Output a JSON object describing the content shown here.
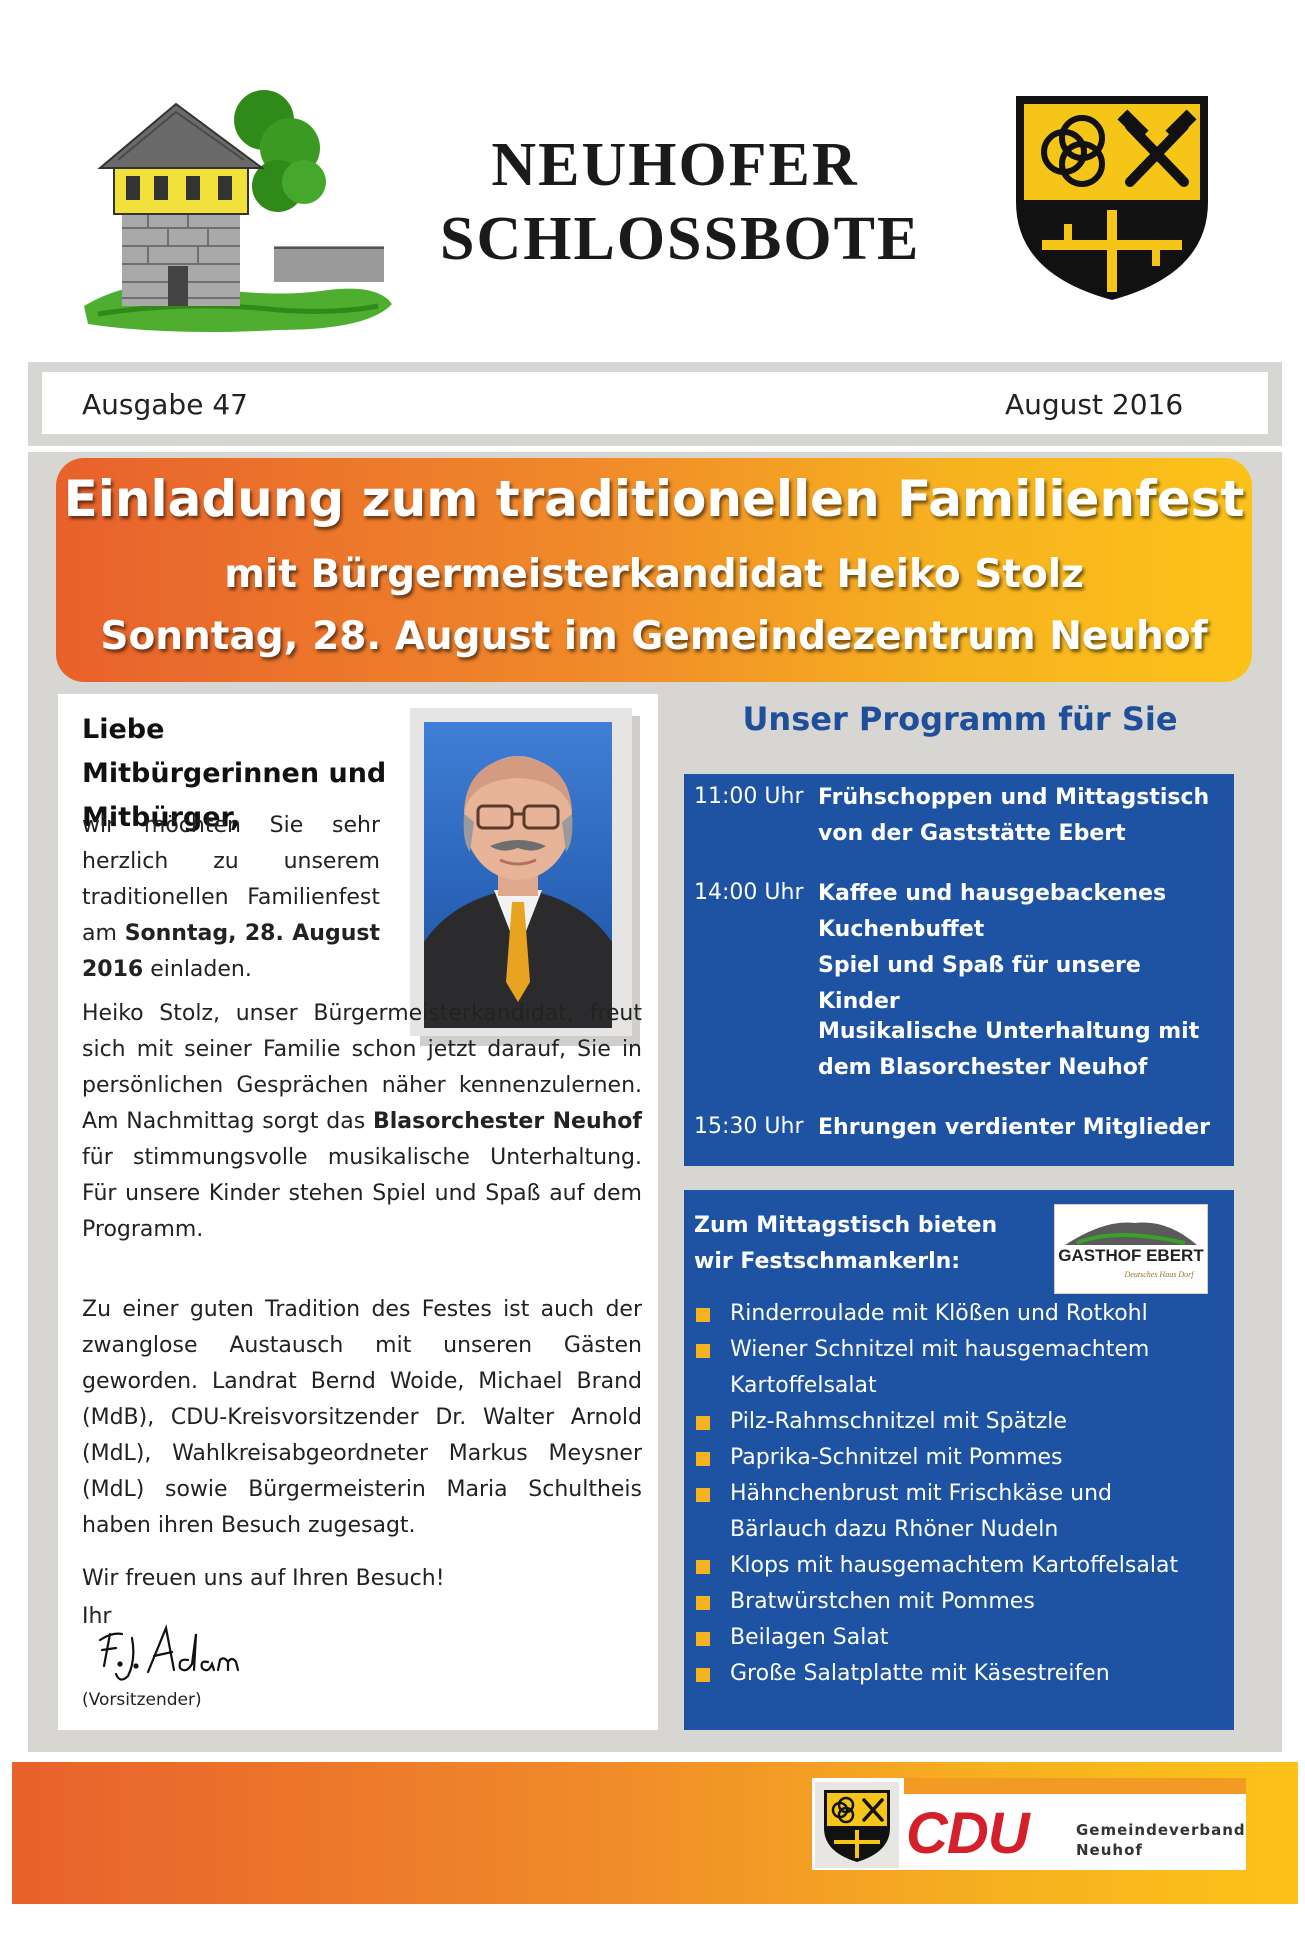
{
  "header": {
    "title_line1": "NEUHOFER",
    "title_line2": "SCHLOSSBOTE",
    "tower_logo": "tower-illustration",
    "crest_icon": "municipal-coat-of-arms"
  },
  "issue": {
    "edition": "Ausgabe  47",
    "date": "August 2016"
  },
  "banner": {
    "title": "Einladung zum traditionellen Familienfest",
    "subtitle": "mit Bürgermeisterkandidat Heiko Stolz",
    "date_line": "Sonntag, 28. August im Gemeindezentrum Neuhof"
  },
  "letter": {
    "greeting": "Liebe Mitbürgerinnen und Mitbürger,",
    "p1_text": "wir möchten Sie sehr herzlich zu unserem traditionellen Familienfest am ",
    "p1_bold": "Sonntag, 28. August 2016",
    "p1_tail": " einladen.",
    "p2_text": "Heiko Stolz, unser Bürgermeisterkandidat, freut sich mit seiner Familie schon jetzt darauf, Sie in persönlichen Gesprächen näher kennenzulernen. Am Nachmittag sorgt das ",
    "p2_bold": "Blasorchester Neuhof",
    "p2_tail": " für stimmungsvolle musikalische Unterhaltung. Für unsere Kinder stehen Spiel und Spaß auf dem Programm.",
    "p3_text": "Zu einer guten Tradition des Festes ist auch der zwanglose Austausch mit unseren Gästen geworden. Landrat Bernd Woide, Michael Brand (MdB), CDU-Kreisvorsitzender Dr. Walter Arnold (MdL), Wahlkreisabgeordneter Markus Meysner (MdL) sowie Bürgermeisterin Maria Schultheis haben ihren Besuch zugesagt.",
    "closing": "Wir freuen uns auf Ihren Besuch!",
    "ihr": "Ihr",
    "signature": "F. J. Adam",
    "role": "(Vorsitzender)",
    "photo": "portrait-photo"
  },
  "programme": {
    "title": "Unser Programm für Sie",
    "items": [
      {
        "time": "11:00 Uhr",
        "text": "Frühschoppen und Mittagstisch von der Gaststätte Ebert"
      },
      {
        "time": "14:00 Uhr",
        "text": "Kaffee und hausgebackenes Kuchenbuffet"
      },
      {
        "time": "",
        "text": "Spiel und Spaß für unsere Kinder"
      },
      {
        "time": "",
        "text": "Musikalische Unterhaltung mit dem Blasorchester Neuhof"
      },
      {
        "time": "15:30 Uhr",
        "text": "Ehrungen verdienter Mitglieder"
      }
    ]
  },
  "menu": {
    "heading": "Zum Mittagstisch bieten wir Festschmankerln:",
    "gasthof_logo": "GASTHOF EBERT",
    "gasthof_tagline": "Deutsches Haus Dorf",
    "items": [
      "Rinderroulade  mit Klößen und Rotkohl",
      "Wiener Schnitzel  mit  hausgemachtem Kartoffelsalat",
      "Pilz-Rahmschnitzel mit Spätzle",
      "Paprika-Schnitzel mit Pommes",
      "Hähnchenbrust mit Frischkäse und Bärlauch dazu Rhöner Nudeln",
      "Klops mit hausgemachtem Kartoffelsalat",
      "Bratwürstchen mit Pommes",
      "Beilagen Salat",
      "Große Salatplatte mit Käsestreifen"
    ]
  },
  "footer": {
    "party": "CDU",
    "org_line1": "Gemeindeverband",
    "org_line2": "Neuhof"
  },
  "colors": {
    "blue": "#1d53a2",
    "orange": "#e8612c",
    "yellow": "#fcc21a",
    "cdu_red": "#d4202b"
  }
}
